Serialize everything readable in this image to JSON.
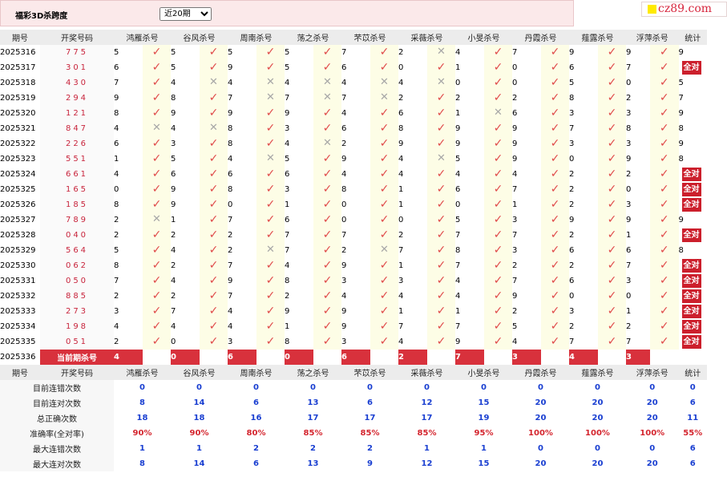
{
  "header": {
    "title": "福彩3D杀跨度",
    "period_select": "近20期",
    "period_options": [
      "近20期"
    ]
  },
  "brand": {
    "text": "cz89.com"
  },
  "columns": [
    "期号",
    "开奖号码",
    "鸿雁杀号",
    "谷风杀号",
    "周南杀号",
    "荡之杀号",
    "芣苡杀号",
    "采薇杀号",
    "小旻杀号",
    "丹霞杀号",
    "薤露杀号",
    "浮萍杀号",
    "统计"
  ],
  "rows": [
    {
      "issue": "2025316",
      "draw": "775",
      "kills": [
        [
          5,
          1
        ],
        [
          5,
          1
        ],
        [
          5,
          1
        ],
        [
          5,
          1
        ],
        [
          7,
          1
        ],
        [
          2,
          0
        ],
        [
          4,
          1
        ],
        [
          7,
          1
        ],
        [
          9,
          1
        ],
        [
          9,
          1
        ]
      ],
      "stat": "9"
    },
    {
      "issue": "2025317",
      "draw": "301",
      "kills": [
        [
          6,
          1
        ],
        [
          5,
          1
        ],
        [
          9,
          1
        ],
        [
          5,
          1
        ],
        [
          6,
          1
        ],
        [
          0,
          1
        ],
        [
          1,
          1
        ],
        [
          0,
          1
        ],
        [
          6,
          1
        ],
        [
          7,
          1
        ]
      ],
      "stat": "全对"
    },
    {
      "issue": "2025318",
      "draw": "430",
      "kills": [
        [
          7,
          1
        ],
        [
          4,
          0
        ],
        [
          4,
          0
        ],
        [
          4,
          0
        ],
        [
          4,
          0
        ],
        [
          4,
          0
        ],
        [
          0,
          1
        ],
        [
          0,
          1
        ],
        [
          5,
          1
        ],
        [
          0,
          1
        ]
      ],
      "stat": "5"
    },
    {
      "issue": "2025319",
      "draw": "294",
      "kills": [
        [
          9,
          1
        ],
        [
          8,
          1
        ],
        [
          7,
          0
        ],
        [
          7,
          0
        ],
        [
          7,
          0
        ],
        [
          2,
          1
        ],
        [
          2,
          1
        ],
        [
          2,
          1
        ],
        [
          8,
          1
        ],
        [
          2,
          1
        ]
      ],
      "stat": "7"
    },
    {
      "issue": "2025320",
      "draw": "121",
      "kills": [
        [
          8,
          1
        ],
        [
          9,
          1
        ],
        [
          9,
          1
        ],
        [
          9,
          1
        ],
        [
          4,
          1
        ],
        [
          6,
          1
        ],
        [
          1,
          0
        ],
        [
          6,
          1
        ],
        [
          3,
          1
        ],
        [
          3,
          1
        ]
      ],
      "stat": "9"
    },
    {
      "issue": "2025321",
      "draw": "847",
      "kills": [
        [
          4,
          0
        ],
        [
          4,
          0
        ],
        [
          8,
          1
        ],
        [
          3,
          1
        ],
        [
          6,
          1
        ],
        [
          8,
          1
        ],
        [
          9,
          1
        ],
        [
          9,
          1
        ],
        [
          7,
          1
        ],
        [
          8,
          1
        ]
      ],
      "stat": "8"
    },
    {
      "issue": "2025322",
      "draw": "226",
      "kills": [
        [
          6,
          1
        ],
        [
          3,
          1
        ],
        [
          8,
          1
        ],
        [
          4,
          0
        ],
        [
          2,
          1
        ],
        [
          9,
          1
        ],
        [
          9,
          1
        ],
        [
          9,
          1
        ],
        [
          3,
          1
        ],
        [
          3,
          1
        ]
      ],
      "stat": "9"
    },
    {
      "issue": "2025323",
      "draw": "551",
      "kills": [
        [
          1,
          1
        ],
        [
          5,
          1
        ],
        [
          4,
          0
        ],
        [
          5,
          1
        ],
        [
          9,
          1
        ],
        [
          4,
          0
        ],
        [
          5,
          1
        ],
        [
          9,
          1
        ],
        [
          0,
          1
        ],
        [
          9,
          1
        ]
      ],
      "stat": "8"
    },
    {
      "issue": "2025324",
      "draw": "661",
      "kills": [
        [
          4,
          1
        ],
        [
          6,
          1
        ],
        [
          6,
          1
        ],
        [
          6,
          1
        ],
        [
          4,
          1
        ],
        [
          4,
          1
        ],
        [
          4,
          1
        ],
        [
          4,
          1
        ],
        [
          2,
          1
        ],
        [
          2,
          1
        ]
      ],
      "stat": "全对"
    },
    {
      "issue": "2025325",
      "draw": "165",
      "kills": [
        [
          0,
          1
        ],
        [
          9,
          1
        ],
        [
          8,
          1
        ],
        [
          3,
          1
        ],
        [
          8,
          1
        ],
        [
          1,
          1
        ],
        [
          6,
          1
        ],
        [
          7,
          1
        ],
        [
          2,
          1
        ],
        [
          0,
          1
        ]
      ],
      "stat": "全对"
    },
    {
      "issue": "2025326",
      "draw": "185",
      "kills": [
        [
          8,
          1
        ],
        [
          9,
          1
        ],
        [
          0,
          1
        ],
        [
          1,
          1
        ],
        [
          0,
          1
        ],
        [
          1,
          1
        ],
        [
          0,
          1
        ],
        [
          1,
          1
        ],
        [
          2,
          1
        ],
        [
          3,
          1
        ]
      ],
      "stat": "全对"
    },
    {
      "issue": "2025327",
      "draw": "789",
      "kills": [
        [
          2,
          0
        ],
        [
          1,
          1
        ],
        [
          7,
          1
        ],
        [
          6,
          1
        ],
        [
          0,
          1
        ],
        [
          0,
          1
        ],
        [
          5,
          1
        ],
        [
          3,
          1
        ],
        [
          9,
          1
        ],
        [
          9,
          1
        ]
      ],
      "stat": "9"
    },
    {
      "issue": "2025328",
      "draw": "040",
      "kills": [
        [
          2,
          1
        ],
        [
          2,
          1
        ],
        [
          2,
          1
        ],
        [
          7,
          1
        ],
        [
          7,
          1
        ],
        [
          2,
          1
        ],
        [
          7,
          1
        ],
        [
          7,
          1
        ],
        [
          2,
          1
        ],
        [
          1,
          1
        ]
      ],
      "stat": "全对"
    },
    {
      "issue": "2025329",
      "draw": "564",
      "kills": [
        [
          5,
          1
        ],
        [
          4,
          1
        ],
        [
          2,
          0
        ],
        [
          7,
          1
        ],
        [
          2,
          0
        ],
        [
          7,
          1
        ],
        [
          8,
          1
        ],
        [
          3,
          1
        ],
        [
          6,
          1
        ],
        [
          6,
          1
        ]
      ],
      "stat": "8"
    },
    {
      "issue": "2025330",
      "draw": "062",
      "kills": [
        [
          8,
          1
        ],
        [
          2,
          1
        ],
        [
          7,
          1
        ],
        [
          4,
          1
        ],
        [
          9,
          1
        ],
        [
          1,
          1
        ],
        [
          7,
          1
        ],
        [
          2,
          1
        ],
        [
          2,
          1
        ],
        [
          7,
          1
        ]
      ],
      "stat": "全对"
    },
    {
      "issue": "2025331",
      "draw": "050",
      "kills": [
        [
          7,
          1
        ],
        [
          4,
          1
        ],
        [
          9,
          1
        ],
        [
          8,
          1
        ],
        [
          3,
          1
        ],
        [
          3,
          1
        ],
        [
          4,
          1
        ],
        [
          7,
          1
        ],
        [
          6,
          1
        ],
        [
          3,
          1
        ]
      ],
      "stat": "全对"
    },
    {
      "issue": "2025332",
      "draw": "885",
      "kills": [
        [
          2,
          1
        ],
        [
          2,
          1
        ],
        [
          7,
          1
        ],
        [
          2,
          1
        ],
        [
          4,
          1
        ],
        [
          4,
          1
        ],
        [
          4,
          1
        ],
        [
          9,
          1
        ],
        [
          0,
          1
        ],
        [
          0,
          1
        ]
      ],
      "stat": "全对"
    },
    {
      "issue": "2025333",
      "draw": "273",
      "kills": [
        [
          3,
          1
        ],
        [
          7,
          1
        ],
        [
          4,
          1
        ],
        [
          9,
          1
        ],
        [
          9,
          1
        ],
        [
          1,
          1
        ],
        [
          1,
          1
        ],
        [
          2,
          1
        ],
        [
          3,
          1
        ],
        [
          1,
          1
        ]
      ],
      "stat": "全对"
    },
    {
      "issue": "2025334",
      "draw": "198",
      "kills": [
        [
          4,
          1
        ],
        [
          4,
          1
        ],
        [
          4,
          1
        ],
        [
          1,
          1
        ],
        [
          9,
          1
        ],
        [
          7,
          1
        ],
        [
          7,
          1
        ],
        [
          5,
          1
        ],
        [
          2,
          1
        ],
        [
          2,
          1
        ]
      ],
      "stat": "全对"
    },
    {
      "issue": "2025335",
      "draw": "051",
      "kills": [
        [
          2,
          1
        ],
        [
          0,
          1
        ],
        [
          3,
          1
        ],
        [
          8,
          1
        ],
        [
          3,
          1
        ],
        [
          4,
          1
        ],
        [
          9,
          1
        ],
        [
          4,
          1
        ],
        [
          7,
          1
        ],
        [
          7,
          1
        ]
      ],
      "stat": "全对"
    }
  ],
  "current": {
    "issue": "2025336",
    "label": "当前期杀号",
    "kills": [
      "4",
      "0",
      "6",
      "0",
      "6",
      "2",
      "7",
      "3",
      "4",
      "3"
    ]
  },
  "stats": [
    {
      "label": "目前连错次数",
      "values": [
        "0",
        "0",
        "0",
        "0",
        "0",
        "0",
        "0",
        "0",
        "0",
        "0",
        "0"
      ]
    },
    {
      "label": "目前连对次数",
      "values": [
        "8",
        "14",
        "6",
        "13",
        "6",
        "12",
        "15",
        "20",
        "20",
        "20",
        "6"
      ]
    },
    {
      "label": "总正确次数",
      "values": [
        "18",
        "18",
        "16",
        "17",
        "17",
        "17",
        "19",
        "20",
        "20",
        "20",
        "11"
      ]
    },
    {
      "label": "准确率(全对率)",
      "values": [
        "90%",
        "90%",
        "80%",
        "85%",
        "85%",
        "85%",
        "95%",
        "100%",
        "100%",
        "100%",
        "55%"
      ],
      "pct": true
    },
    {
      "label": "最大连错次数",
      "values": [
        "1",
        "1",
        "2",
        "2",
        "2",
        "1",
        "1",
        "0",
        "0",
        "0",
        "6"
      ]
    },
    {
      "label": "最大连对次数",
      "values": [
        "8",
        "14",
        "6",
        "13",
        "9",
        "12",
        "15",
        "20",
        "20",
        "20",
        "6"
      ]
    }
  ],
  "symbols": {
    "correct": "✓",
    "wrong": "✕"
  },
  "colors": {
    "accent_red": "#cc1f2c",
    "stat_blue": "#1a3fd1",
    "check_red": "#e04a4a",
    "draw_red": "#c8243c"
  }
}
